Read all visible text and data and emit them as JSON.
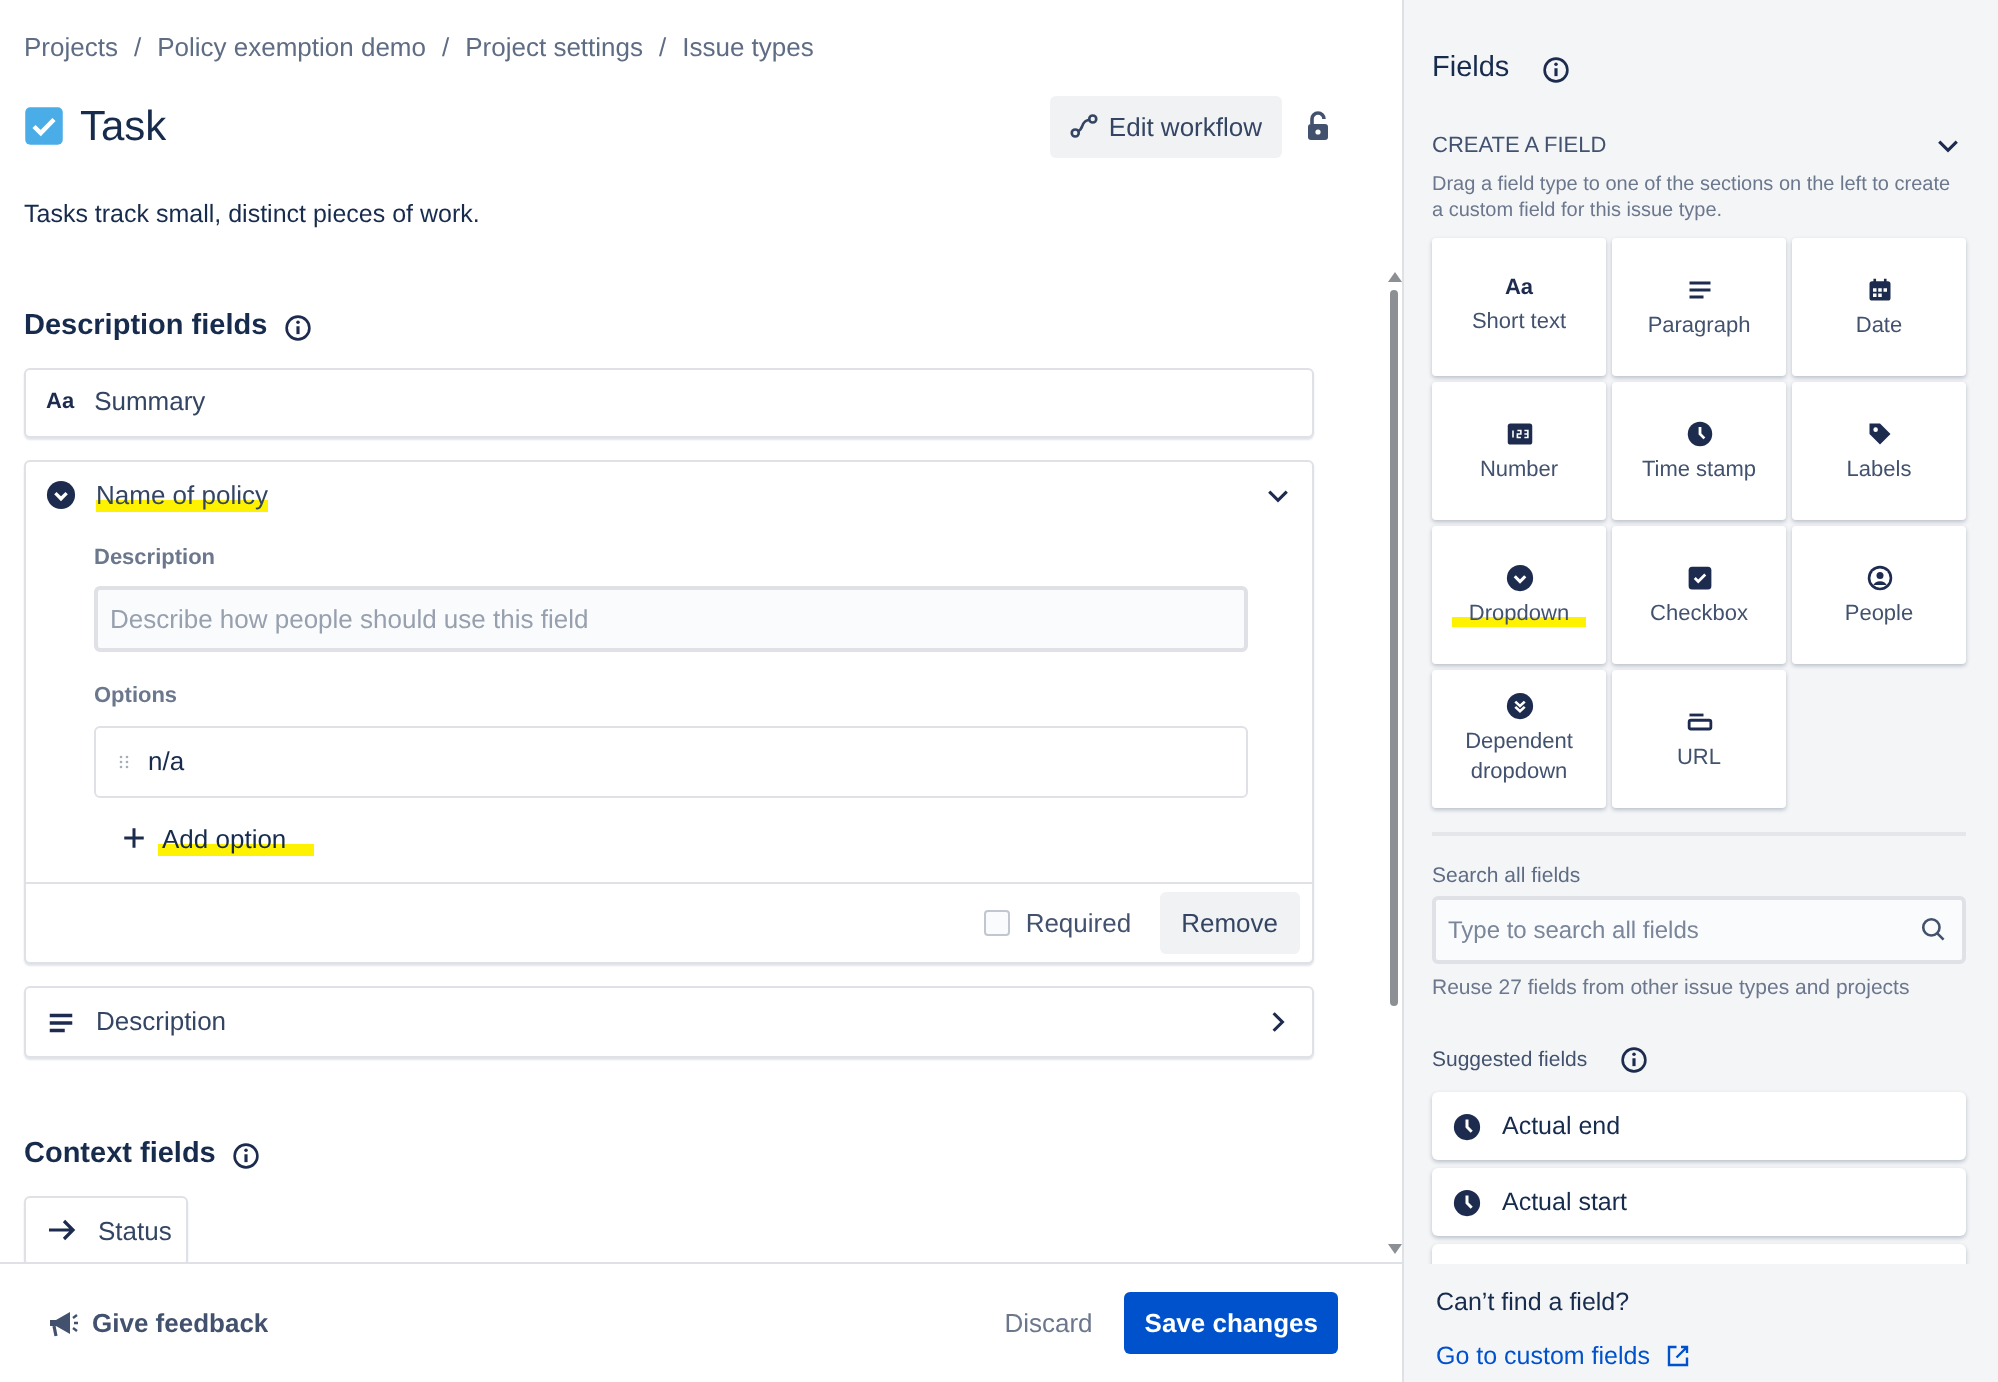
{
  "breadcrumbs": [
    "Projects",
    "Policy exemption demo",
    "Project settings",
    "Issue types"
  ],
  "breadcrumb_separators": [
    "/",
    "/",
    "/"
  ],
  "issue_type": {
    "title": "Task",
    "description": "Tasks track small, distinct pieces of work.",
    "edit_button": "Edit workflow",
    "locked": false
  },
  "description_fields": {
    "heading": "Description fields",
    "fields": [
      {
        "kind": "short-text",
        "icon_text": "Aa",
        "label": "Summary",
        "collapsible": false,
        "highlighted": false
      },
      {
        "kind": "dropdown",
        "label": "Name of policy",
        "collapsible": true,
        "expanded": true,
        "highlighted": true,
        "description_label": "Description",
        "description_placeholder": "Describe how people should use this field",
        "options_label": "Options",
        "options": [
          "n/a"
        ],
        "add_option": {
          "label": "Add option",
          "highlighted": true
        },
        "required": {
          "label": "Required",
          "checked": false
        },
        "remove_button": "Remove"
      },
      {
        "kind": "paragraph",
        "label": "Description",
        "collapsible": true,
        "expanded": false,
        "highlighted": false
      }
    ]
  },
  "context_fields": {
    "heading": "Context fields",
    "fields": [
      {
        "kind": "status",
        "label": "Status"
      }
    ]
  },
  "footer": {
    "feedback": "Give feedback",
    "discard": "Discard",
    "save": "Save changes"
  },
  "panel": {
    "title": "Fields",
    "create_heading": "CREATE A FIELD",
    "create_expanded": true,
    "create_help": "Drag a field type to one of the sections on the left to create a custom field for this issue type.",
    "field_types": [
      {
        "kind": "short-text",
        "icon_text": "Aa",
        "label": "Short text",
        "highlighted": false
      },
      {
        "kind": "paragraph",
        "label": "Paragraph",
        "highlighted": false
      },
      {
        "kind": "date",
        "label": "Date",
        "highlighted": false
      },
      {
        "kind": "number",
        "label": "Number",
        "highlighted": false
      },
      {
        "kind": "time",
        "label": "Time stamp",
        "highlighted": false
      },
      {
        "kind": "labels",
        "label": "Labels",
        "highlighted": false
      },
      {
        "kind": "dropdown",
        "label": "Dropdown",
        "highlighted": true
      },
      {
        "kind": "checkbox",
        "label": "Checkbox",
        "highlighted": false
      },
      {
        "kind": "people",
        "label": "People",
        "highlighted": false
      },
      {
        "kind": "dependent",
        "label": "Dependent dropdown",
        "highlighted": false
      },
      {
        "kind": "url",
        "label": "URL",
        "highlighted": false
      }
    ],
    "search_label": "Search all fields",
    "search_placeholder": "Type to search all fields",
    "reuse_note": "Reuse 27 fields from other issue types and projects",
    "suggested_heading": "Suggested fields",
    "suggested": [
      {
        "kind": "time",
        "label": "Actual end"
      },
      {
        "kind": "time",
        "label": "Actual start"
      }
    ],
    "cant_find": "Can’t find a field?",
    "custom_link": "Go to custom fields"
  }
}
